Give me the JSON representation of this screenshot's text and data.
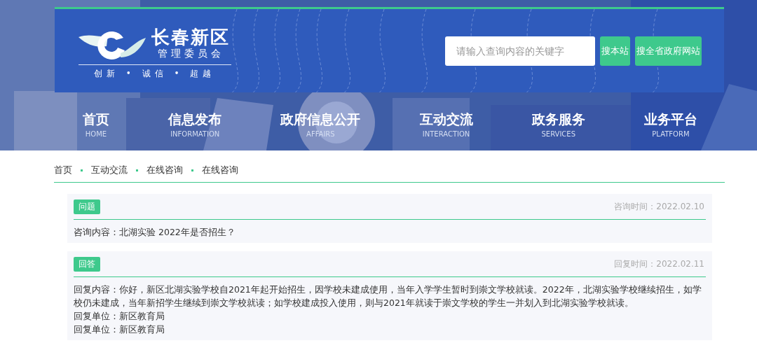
{
  "header": {
    "site_name": "长春新区",
    "site_subtitle": "管理委员会",
    "slogan": "创新 • 诚信 • 超越",
    "search": {
      "placeholder": "请输入查询内容的关键字"
    },
    "buttons": [
      "搜本站",
      "搜全省政府网站"
    ]
  },
  "nav": [
    {
      "label": "首页",
      "en": "HOME"
    },
    {
      "label": "信息发布",
      "en": "INFORMATION"
    },
    {
      "label": "政府信息公开",
      "en": "AFFAIRS"
    },
    {
      "label": "互动交流",
      "en": "INTERACTION"
    },
    {
      "label": "政务服务",
      "en": "SERVICES"
    },
    {
      "label": "业务平台",
      "en": "PLATFORM"
    }
  ],
  "breadcrumb": [
    "首页",
    "互动交流",
    "在线咨询",
    "在线咨询"
  ],
  "cards": [
    {
      "tag": "问题",
      "time": "咨询时间：2022.02.10",
      "lines": [
        "咨询内容：北湖实验 2022年是否招生？"
      ]
    },
    {
      "tag": "回答",
      "time": "回复时间：2022.02.11",
      "lines": [
        "回复内容：你好，新区北湖实验学校自2021年起开始招生，因学校未建成使用，当年入学学生暂时到崇文学校就读。2022年，北湖实验学校继续招生，如学校仍未建成，当年新招学生继续到崇文学校就读；如学校建成投入使用，则与2021年就读于崇文学校的学生一并划入到北湖实验学校就读。",
        "回复单位：新区教育局",
        "回复单位：新区教育局"
      ]
    }
  ]
}
